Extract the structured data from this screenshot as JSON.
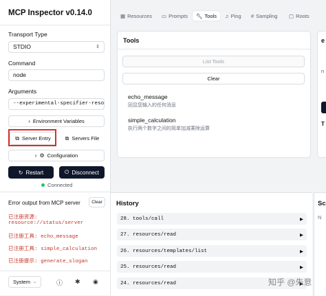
{
  "app_title": "MCP Inspector v0.14.0",
  "transport": {
    "label": "Transport Type",
    "value": "STDIO"
  },
  "command": {
    "label": "Command",
    "value": "node"
  },
  "arguments": {
    "label": "Arguments",
    "value": "--experimental-specifier-resolu"
  },
  "env_button": "Environment Variables",
  "server_entry_button": "Server Entry",
  "servers_file_button": "Servers File",
  "configuration_button": "Configuration",
  "restart_button": "Restart",
  "disconnect_button": "Disconnect",
  "status": {
    "text": "Connected",
    "color": "#22c55e"
  },
  "error_output": {
    "title": "Error output from MCP server",
    "clear_label": "Clear",
    "lines": [
      "已注册资源:",
      "resource://status/server",
      "已注册工具: echo_message",
      "已注册工具: simple_calculation",
      "已注册提示: generate_slogan"
    ]
  },
  "theme_select": "System",
  "tabs": [
    "Resources",
    "Prompts",
    "Tools",
    "Ping",
    "Sampling",
    "Roots"
  ],
  "active_tab": "Tools",
  "tools_panel": {
    "title": "Tools",
    "list_tools_label": "List Tools",
    "clear_label": "Clear",
    "tools": [
      {
        "name": "echo_message",
        "description": "回显您输入的任何消息"
      },
      {
        "name": "simple_calculation",
        "description": "执行两个数字之间的简单加减乘除运算"
      }
    ]
  },
  "right_panel": {
    "partial_title": "e",
    "partial_text": "n",
    "partial_title_2": "T"
  },
  "history": {
    "title": "History",
    "items": [
      "28. tools/call",
      "27. resources/read",
      "26. resources/templates/list",
      "25. resources/read",
      "24. resources/read"
    ]
  },
  "right_partial": {
    "title": "Sc",
    "text": "N"
  },
  "watermark": "知乎 @朱意",
  "colors": {
    "highlight_box": "#d32f2f",
    "dark_button": "#0f172a",
    "error_text": "#c0392b"
  }
}
